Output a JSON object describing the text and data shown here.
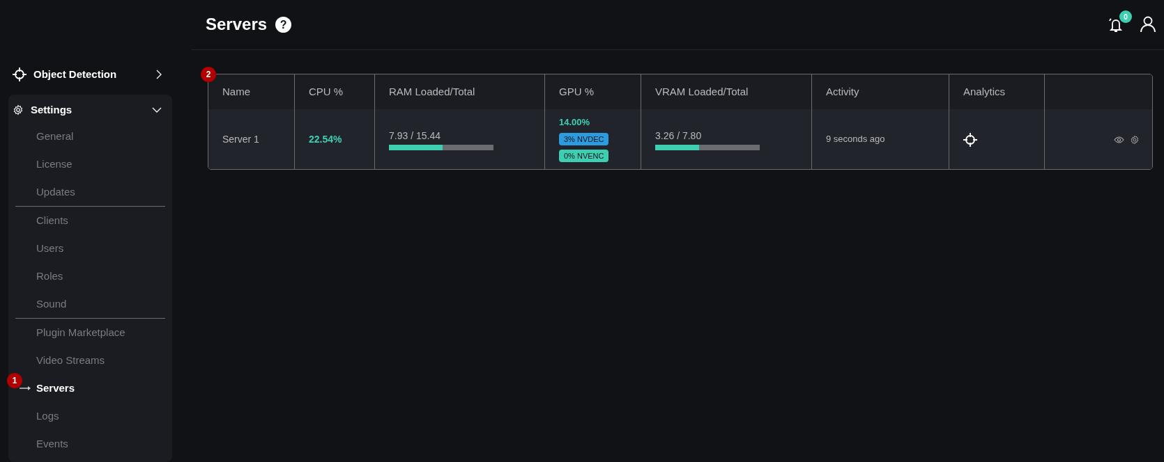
{
  "header": {
    "title": "Servers",
    "help": "?",
    "notification_count": "0"
  },
  "sidebar": {
    "items": [
      {
        "label": "Object Detection",
        "kind": "target",
        "expanded": false
      },
      {
        "label": "Settings",
        "kind": "gear",
        "expanded": true,
        "groups": [
          [
            {
              "label": "General",
              "selected": false
            },
            {
              "label": "License",
              "selected": false
            },
            {
              "label": "Updates",
              "selected": false
            }
          ],
          [
            {
              "label": "Clients",
              "selected": false
            },
            {
              "label": "Users",
              "selected": false
            },
            {
              "label": "Roles",
              "selected": false
            },
            {
              "label": "Sound",
              "selected": false
            }
          ],
          [
            {
              "label": "Plugin Marketplace",
              "selected": false
            },
            {
              "label": "Video Streams",
              "selected": false
            },
            {
              "label": "Servers",
              "selected": true,
              "annotation": "1"
            },
            {
              "label": "Logs",
              "selected": false
            },
            {
              "label": "Events",
              "selected": false
            }
          ]
        ]
      }
    ]
  },
  "table": {
    "annotation": "2",
    "columns": [
      "Name",
      "CPU %",
      "RAM Loaded/Total",
      "GPU %",
      "VRAM Loaded/Total",
      "Activity",
      "Analytics"
    ],
    "rows": [
      {
        "name": "Server 1",
        "cpu": "22.54%",
        "ram": {
          "reading": "7.93 / 15.44",
          "level": 0.514
        },
        "gpu": "14.00%",
        "gpu_tags": [
          {
            "label": "3% NVDEC",
            "color": "#2d9be0"
          },
          {
            "label": "0% NVENC",
            "color": "#3ecfb2"
          }
        ],
        "vram": {
          "reading": "3.26 / 7.80",
          "level": 0.418
        },
        "activity": "9 seconds ago"
      }
    ]
  }
}
